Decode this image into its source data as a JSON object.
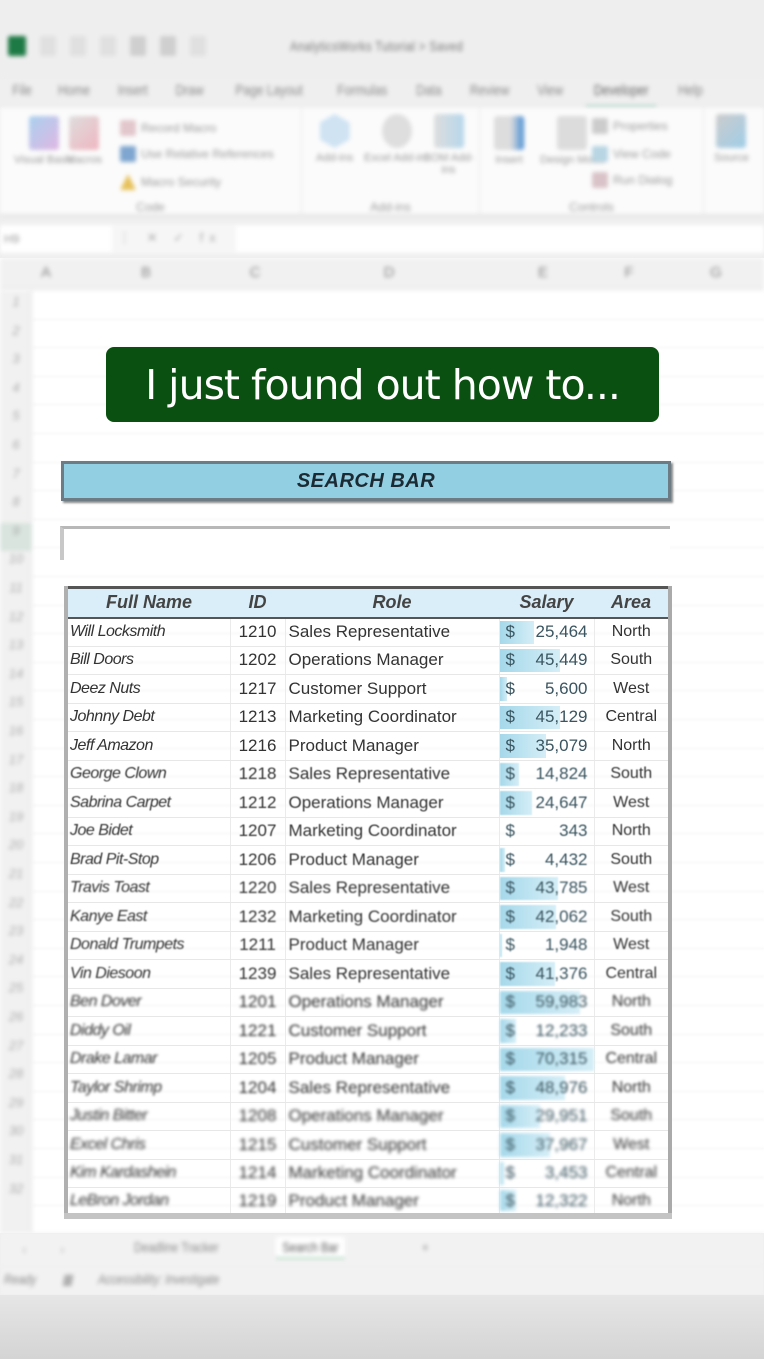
{
  "window": {
    "title": "AnalyticsWorks Tutorial > Saved"
  },
  "ribbon": {
    "tabs": [
      "File",
      "Home",
      "Insert",
      "Draw",
      "Page Layout",
      "Formulas",
      "Data",
      "Review",
      "View",
      "Developer",
      "Help"
    ],
    "active_tab": "Developer",
    "groups": {
      "code": {
        "label": "Code",
        "visual_basic": "Visual Basic",
        "macros": "Macros",
        "record_macro": "Record Macro",
        "relative_refs": "Use Relative References",
        "macro_security": "Macro Security"
      },
      "addins": {
        "label": "Add-ins",
        "addins": "Add-ins",
        "excel_addins": "Excel Add-ins",
        "com_addins": "COM Add-ins"
      },
      "controls": {
        "label": "Controls",
        "insert": "Insert",
        "design_mode": "Design Mode",
        "properties": "Properties",
        "view_code": "View Code",
        "run_dialog": "Run Dialog"
      },
      "xml": {
        "source": "Source"
      }
    }
  },
  "formula_bar": {
    "name_box": "H9",
    "fx": "fx",
    "value": ""
  },
  "columns": [
    "A",
    "B",
    "C",
    "D",
    "E",
    "F",
    "G"
  ],
  "rows": [
    "1",
    "2",
    "3",
    "4",
    "5",
    "6",
    "7",
    "8",
    "9",
    "10",
    "11",
    "12",
    "13",
    "14",
    "15",
    "16",
    "17",
    "18",
    "19",
    "20",
    "21",
    "22",
    "23",
    "24",
    "25",
    "26",
    "27",
    "28",
    "29",
    "30",
    "31",
    "32"
  ],
  "caption": "I just found out how to...",
  "search": {
    "title": "SEARCH BAR",
    "value": "",
    "placeholder": ""
  },
  "table": {
    "headers": [
      "Full Name",
      "ID",
      "Role",
      "Salary",
      "Area"
    ],
    "max_salary": 70315,
    "rows": [
      {
        "name": "Will Locksmith",
        "id": "1210",
        "role": "Sales Representative",
        "salary": 25464,
        "area": "North"
      },
      {
        "name": "Bill Doors",
        "id": "1202",
        "role": "Operations Manager",
        "salary": 45449,
        "area": "South"
      },
      {
        "name": "Deez Nuts",
        "id": "1217",
        "role": "Customer Support",
        "salary": 5600,
        "area": "West"
      },
      {
        "name": "Johnny Debt",
        "id": "1213",
        "role": "Marketing Coordinator",
        "salary": 45129,
        "area": "Central"
      },
      {
        "name": "Jeff Amazon",
        "id": "1216",
        "role": "Product Manager",
        "salary": 35079,
        "area": "North"
      },
      {
        "name": "George Clown",
        "id": "1218",
        "role": "Sales Representative",
        "salary": 14824,
        "area": "South"
      },
      {
        "name": "Sabrina Carpet",
        "id": "1212",
        "role": "Operations Manager",
        "salary": 24647,
        "area": "West"
      },
      {
        "name": "Joe Bidet",
        "id": "1207",
        "role": "Marketing Coordinator",
        "salary": 343,
        "area": "North"
      },
      {
        "name": "Brad Pit-Stop",
        "id": "1206",
        "role": "Product Manager",
        "salary": 4432,
        "area": "South"
      },
      {
        "name": "Travis Toast",
        "id": "1220",
        "role": "Sales Representative",
        "salary": 43785,
        "area": "West"
      },
      {
        "name": "Kanye East",
        "id": "1232",
        "role": "Marketing Coordinator",
        "salary": 42062,
        "area": "South"
      },
      {
        "name": "Donald Trumpets",
        "id": "1211",
        "role": "Product Manager",
        "salary": 1948,
        "area": "West"
      },
      {
        "name": "Vin Diesoon",
        "id": "1239",
        "role": "Sales Representative",
        "salary": 41376,
        "area": "Central"
      },
      {
        "name": "Ben Dover",
        "id": "1201",
        "role": "Operations Manager",
        "salary": 59983,
        "area": "North"
      },
      {
        "name": "Diddy Oil",
        "id": "1221",
        "role": "Customer Support",
        "salary": 12233,
        "area": "South"
      },
      {
        "name": "Drake Lamar",
        "id": "1205",
        "role": "Product Manager",
        "salary": 70315,
        "area": "Central"
      },
      {
        "name": "Taylor Shrimp",
        "id": "1204",
        "role": "Sales Representative",
        "salary": 48976,
        "area": "North"
      },
      {
        "name": "Justin Bitter",
        "id": "1208",
        "role": "Operations Manager",
        "salary": 29951,
        "area": "South"
      },
      {
        "name": "Excel Chris",
        "id": "1215",
        "role": "Customer Support",
        "salary": 37967,
        "area": "West"
      },
      {
        "name": "Kim Kardashein",
        "id": "1214",
        "role": "Marketing Coordinator",
        "salary": 3453,
        "area": "Central"
      },
      {
        "name": "LeBron Jordan",
        "id": "1219",
        "role": "Product Manager",
        "salary": 12322,
        "area": "North"
      }
    ]
  },
  "sheet_tabs": {
    "tabs": [
      "Deadline Tracker",
      "Search Bar"
    ],
    "active": "Search Bar",
    "add": "+"
  },
  "status_bar": {
    "ready": "Ready",
    "accessibility": "Accessibility: Investigate"
  },
  "colors": {
    "caption_bg": "#0a5010",
    "search_header_bg": "#93cfe3",
    "table_header_bg": "#d9eef8",
    "databar": "#a5d8ea",
    "excel_green": "#1e7a45"
  }
}
